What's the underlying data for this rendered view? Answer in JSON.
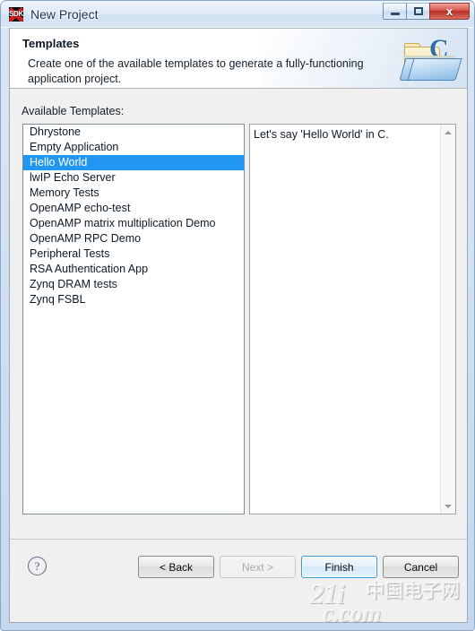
{
  "window": {
    "title": "New Project",
    "icon_name": "sdk-icon",
    "icon_text": "SDK",
    "caption_buttons": [
      {
        "name": "minimize-button",
        "label": "–"
      },
      {
        "name": "maximize-button",
        "label": "□"
      },
      {
        "name": "close-button",
        "label": "x"
      }
    ]
  },
  "header": {
    "title": "Templates",
    "description": "Create one of the available templates to generate a fully-functioning application project.",
    "icon_name": "folder-c-icon",
    "icon_letter": "C"
  },
  "body": {
    "list_label": "Available Templates:",
    "templates": [
      {
        "label": "Dhrystone",
        "selected": false
      },
      {
        "label": "Empty Application",
        "selected": false
      },
      {
        "label": "Hello World",
        "selected": true
      },
      {
        "label": "lwIP Echo Server",
        "selected": false
      },
      {
        "label": "Memory Tests",
        "selected": false
      },
      {
        "label": "OpenAMP echo-test",
        "selected": false
      },
      {
        "label": "OpenAMP matrix multiplication Demo",
        "selected": false
      },
      {
        "label": "OpenAMP RPC Demo",
        "selected": false
      },
      {
        "label": "Peripheral Tests",
        "selected": false
      },
      {
        "label": "RSA Authentication App",
        "selected": false
      },
      {
        "label": "Zynq DRAM tests",
        "selected": false
      },
      {
        "label": "Zynq FSBL",
        "selected": false
      }
    ],
    "description_panel": {
      "text": "Let's say 'Hello World' in C.",
      "scroll_up_icon": "scroll-up-arrow-icon",
      "scroll_down_icon": "scroll-down-arrow-icon"
    }
  },
  "footer": {
    "help_label": "?",
    "buttons": [
      {
        "name": "back-button",
        "label": "< Back",
        "state": "enabled"
      },
      {
        "name": "next-button",
        "label": "Next >",
        "state": "disabled"
      },
      {
        "name": "finish-button",
        "label": "Finish",
        "state": "default"
      },
      {
        "name": "cancel-button",
        "label": "Cancel",
        "state": "enabled"
      }
    ]
  },
  "watermark": {
    "line1": "21i",
    "cjk": "中国电子网",
    "line2": "c.com"
  },
  "colors": {
    "selection": "#2196f3",
    "accent": "#3c9ad9",
    "title_text": "#17334f"
  }
}
